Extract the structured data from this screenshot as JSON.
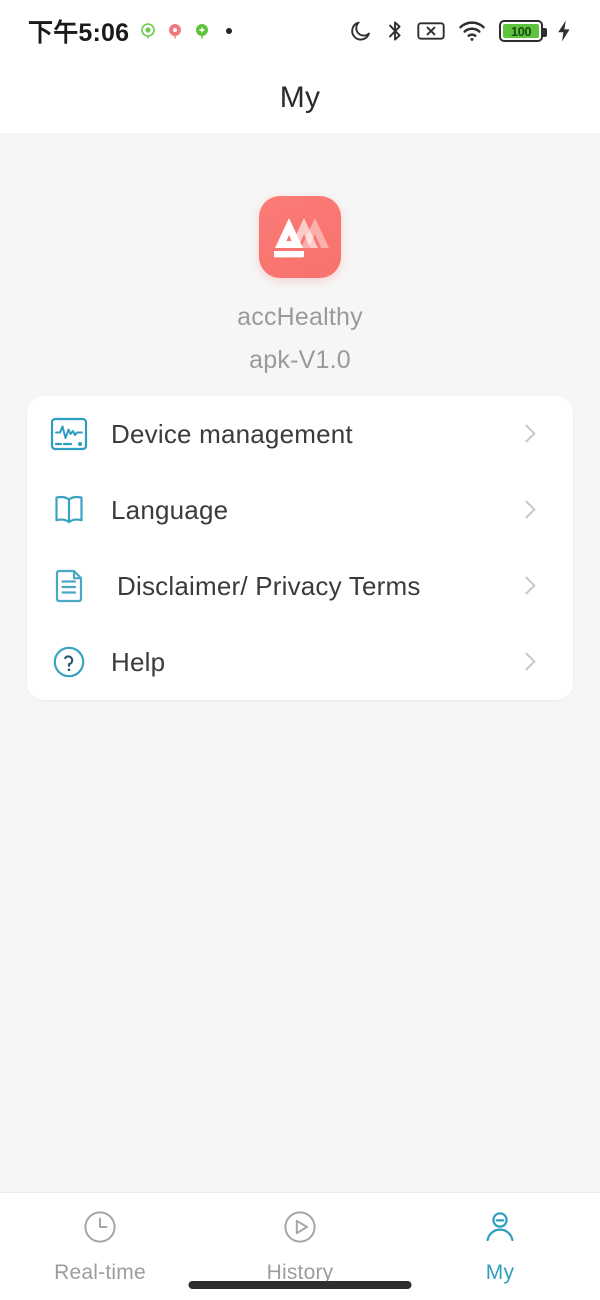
{
  "status_bar": {
    "time": "下午5:06",
    "notification_icons": [
      {
        "name": "app-notification-green",
        "color": "#5ec43c",
        "glyph": "◎"
      },
      {
        "name": "app-notification-red",
        "color": "#ee6c6c",
        "glyph": "●"
      },
      {
        "name": "app-notification-green-2",
        "color": "#5ec43c",
        "glyph": "◉"
      }
    ],
    "overflow_dot": "•",
    "right_icons": [
      {
        "name": "do-not-disturb-icon",
        "label": "Do not disturb"
      },
      {
        "name": "bluetooth-icon",
        "label": "Bluetooth"
      },
      {
        "name": "sim-disabled-icon",
        "label": "No SIM"
      },
      {
        "name": "wifi-icon",
        "label": "Wi-Fi"
      }
    ],
    "battery": {
      "percent": "100",
      "fill_color": "#5ec43c",
      "charging": true
    }
  },
  "header": {
    "title": "My"
  },
  "app": {
    "icon_name": "accHealthy-app-icon",
    "icon_bg_color": "#f8726d",
    "name": "accHealthy",
    "version": "apk-V1.0"
  },
  "menu": {
    "items": [
      {
        "id": "device-management",
        "label": "Device management",
        "icon": "device-monitor-icon",
        "icon_color": "#2f9dbf"
      },
      {
        "id": "language",
        "label": "Language",
        "icon": "book-icon",
        "icon_color": "#3aa3c2"
      },
      {
        "id": "disclaimer-privacy-terms",
        "label": "Disclaimer/ Privacy Terms",
        "icon": "document-icon",
        "icon_color": "#4aa8c4"
      },
      {
        "id": "help",
        "label": "Help",
        "icon": "question-circle-icon",
        "icon_color": "#3aa3c2"
      }
    ],
    "chevron": "chevron-right-icon"
  },
  "tabbar": {
    "active_color": "#2f9dbf",
    "inactive_color": "#9d9d9d",
    "tabs": [
      {
        "id": "real-time",
        "label": "Real-time",
        "icon": "clock-icon",
        "active": false
      },
      {
        "id": "history",
        "label": "History",
        "icon": "play-circle-icon",
        "active": false
      },
      {
        "id": "my",
        "label": "My",
        "icon": "person-icon",
        "active": true
      }
    ]
  }
}
